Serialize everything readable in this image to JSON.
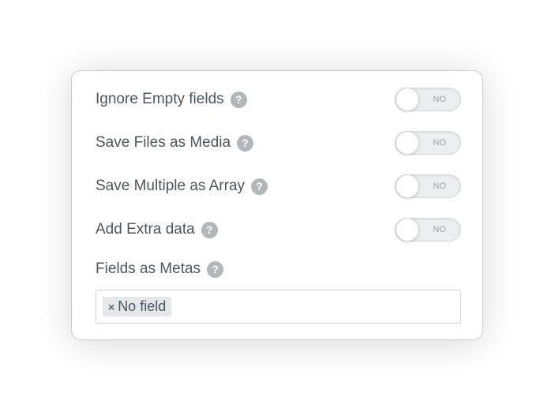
{
  "settings": {
    "rows": [
      {
        "label": "Ignore Empty fields",
        "help": "?",
        "state": "NO"
      },
      {
        "label": "Save Files as Media",
        "help": "?",
        "state": "NO"
      },
      {
        "label": "Save Multiple as Array",
        "help": "?",
        "state": "NO"
      },
      {
        "label": "Add Extra data",
        "help": "?",
        "state": "NO"
      }
    ],
    "fields_as_metas": {
      "label": "Fields as Metas",
      "help": "?",
      "tags": [
        {
          "remove": "×",
          "text": "No field"
        }
      ]
    }
  },
  "icons": {
    "help": "question-circle-icon",
    "remove": "close-icon"
  },
  "colors": {
    "label_text": "#4d565e",
    "help_bg": "#b4b7ba",
    "toggle_bg": "#eceef0",
    "border": "#c9cdd1"
  }
}
